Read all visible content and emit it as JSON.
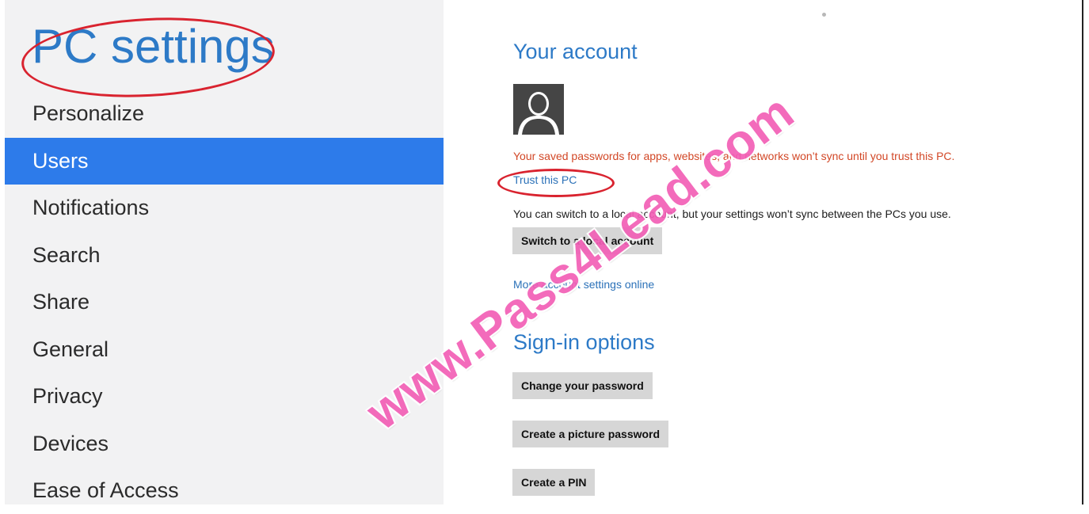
{
  "app_title": "PC settings",
  "nav": {
    "items": [
      {
        "label": "Personalize",
        "selected": false
      },
      {
        "label": "Users",
        "selected": true
      },
      {
        "label": "Notifications",
        "selected": false
      },
      {
        "label": "Search",
        "selected": false
      },
      {
        "label": "Share",
        "selected": false
      },
      {
        "label": "General",
        "selected": false
      },
      {
        "label": "Privacy",
        "selected": false
      },
      {
        "label": "Devices",
        "selected": false
      },
      {
        "label": "Ease of Access",
        "selected": false
      }
    ]
  },
  "account": {
    "title": "Your account",
    "avatar_icon": "user-silhouette-icon",
    "sync_warning": "Your saved passwords for apps, websites, and networks won’t sync until you trust this PC.",
    "trust_link": "Trust this PC",
    "local_info": "You can switch to a local account, but your settings won’t sync between the PCs you use.",
    "switch_button": "Switch to a local account",
    "more_link": "More account settings online"
  },
  "signin": {
    "title": "Sign-in options",
    "change_password_button": "Change your password",
    "picture_password_button": "Create a picture password",
    "pin_button": "Create a PIN"
  },
  "watermark": "www.Pass4Lead.com",
  "colors": {
    "accent": "#2d7ac7",
    "selected_bg": "#2d7bea",
    "warning": "#d24726",
    "link": "#2b71b8",
    "annotation": "#d9232f",
    "watermark": "#f25fb6"
  }
}
